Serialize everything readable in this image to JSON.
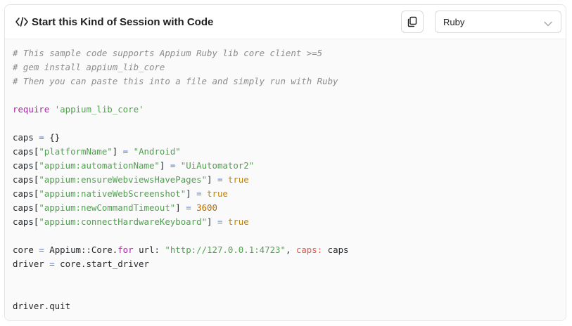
{
  "header": {
    "title": "Start this Kind of Session with Code",
    "language_selected": "Ruby"
  },
  "icons": {
    "title_icon": "code-icon",
    "copy_icon": "copy-icon",
    "dropdown_icon": "chevron-down-icon"
  },
  "colors": {
    "comment": "#8c8c8c",
    "keyword": "#a626a4",
    "string": "#50a14f",
    "boolean": "#c18401",
    "number": "#b76b01",
    "operator": "#4078f2",
    "symbol": "#e45649"
  },
  "code": {
    "lines": [
      [
        {
          "t": "# This sample code supports Appium Ruby lib core client >=5",
          "c": "comment"
        }
      ],
      [
        {
          "t": "# gem install appium_lib_core",
          "c": "comment"
        }
      ],
      [
        {
          "t": "# Then you can paste this into a file and simply run with Ruby",
          "c": "comment"
        }
      ],
      [],
      [
        {
          "t": "require",
          "c": "keyword"
        },
        {
          "t": " ",
          "c": "plain"
        },
        {
          "t": "'appium_lib_core'",
          "c": "string"
        }
      ],
      [],
      [
        {
          "t": "caps",
          "c": "plain"
        },
        {
          "t": " = ",
          "c": "op"
        },
        {
          "t": "{}",
          "c": "plain"
        }
      ],
      [
        {
          "t": "caps[",
          "c": "plain"
        },
        {
          "t": "\"platformName\"",
          "c": "string"
        },
        {
          "t": "]",
          "c": "plain"
        },
        {
          "t": " = ",
          "c": "op"
        },
        {
          "t": "\"Android\"",
          "c": "string"
        }
      ],
      [
        {
          "t": "caps[",
          "c": "plain"
        },
        {
          "t": "\"appium:automationName\"",
          "c": "string"
        },
        {
          "t": "]",
          "c": "plain"
        },
        {
          "t": " = ",
          "c": "op"
        },
        {
          "t": "\"UiAutomator2\"",
          "c": "string"
        }
      ],
      [
        {
          "t": "caps[",
          "c": "plain"
        },
        {
          "t": "\"appium:ensureWebviewsHavePages\"",
          "c": "string"
        },
        {
          "t": "]",
          "c": "plain"
        },
        {
          "t": " = ",
          "c": "op"
        },
        {
          "t": "true",
          "c": "bool"
        }
      ],
      [
        {
          "t": "caps[",
          "c": "plain"
        },
        {
          "t": "\"appium:nativeWebScreenshot\"",
          "c": "string"
        },
        {
          "t": "]",
          "c": "plain"
        },
        {
          "t": " = ",
          "c": "op"
        },
        {
          "t": "true",
          "c": "bool"
        }
      ],
      [
        {
          "t": "caps[",
          "c": "plain"
        },
        {
          "t": "\"appium:newCommandTimeout\"",
          "c": "string"
        },
        {
          "t": "]",
          "c": "plain"
        },
        {
          "t": " = ",
          "c": "op"
        },
        {
          "t": "3600",
          "c": "number"
        }
      ],
      [
        {
          "t": "caps[",
          "c": "plain"
        },
        {
          "t": "\"appium:connectHardwareKeyboard\"",
          "c": "string"
        },
        {
          "t": "]",
          "c": "plain"
        },
        {
          "t": " = ",
          "c": "op"
        },
        {
          "t": "true",
          "c": "bool"
        }
      ],
      [],
      [
        {
          "t": "core",
          "c": "plain"
        },
        {
          "t": " = ",
          "c": "op"
        },
        {
          "t": "Appium::Core.",
          "c": "plain"
        },
        {
          "t": "for",
          "c": "keyword"
        },
        {
          "t": " url: ",
          "c": "plain"
        },
        {
          "t": "\"http://127.0.0.1:4723\"",
          "c": "string"
        },
        {
          "t": ", ",
          "c": "plain"
        },
        {
          "t": "caps:",
          "c": "symbol"
        },
        {
          "t": " caps",
          "c": "plain"
        }
      ],
      [
        {
          "t": "driver",
          "c": "plain"
        },
        {
          "t": " = ",
          "c": "op"
        },
        {
          "t": "core.start_driver",
          "c": "plain"
        }
      ],
      [],
      [],
      [
        {
          "t": "driver.quit",
          "c": "plain"
        }
      ]
    ]
  }
}
